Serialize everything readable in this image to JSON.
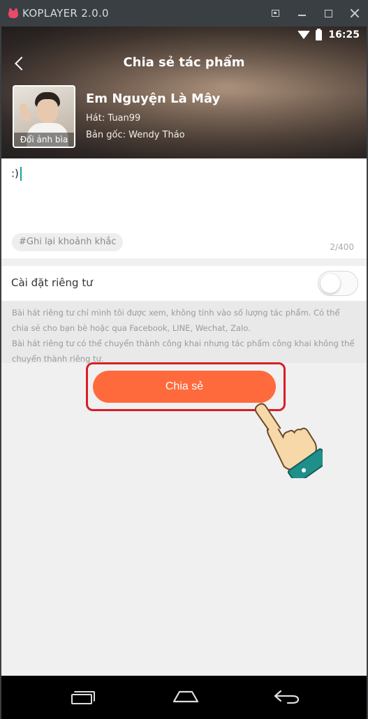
{
  "emulator": {
    "title": "KOPLAYER 2.0.0"
  },
  "status_bar": {
    "time": "16:25"
  },
  "header": {
    "title": "Chia sẻ tác phẩm",
    "cover_label": "Đổi ảnh bìa",
    "song_title": "Em Nguyện Là Mây",
    "artist": "Hát: Tuan99",
    "original": "Bản gốc: Wendy Tháo"
  },
  "caption": {
    "text": ":)",
    "hashtag": "#Ghi lại khoảnh khắc",
    "counter": "2/400"
  },
  "privacy": {
    "label": "Cài đặt riêng tư",
    "enabled": false,
    "note_line1": "Bài hát riêng tư chỉ mình tôi được xem, không tính vào số lượng tác phẩm. Có thể chia sẻ cho bạn bè hoặc qua Facebook, LINE, Wechat, Zalo.",
    "note_line2": "Bài hát riêng tư có thể chuyển thành công khai nhưng tác phẩm công khai không thể chuyển thành riêng tư."
  },
  "actions": {
    "share_label": "Chia sẻ"
  },
  "colors": {
    "accent": "#ff6a3d",
    "highlight_border": "#d81e28",
    "cursor": "#1aa0a0"
  },
  "icons": {
    "status": [
      "wifi-icon",
      "battery-icon"
    ],
    "nav": [
      "recent-apps-icon",
      "home-icon",
      "back-icon"
    ],
    "overlay": "pointing-hand-icon"
  }
}
